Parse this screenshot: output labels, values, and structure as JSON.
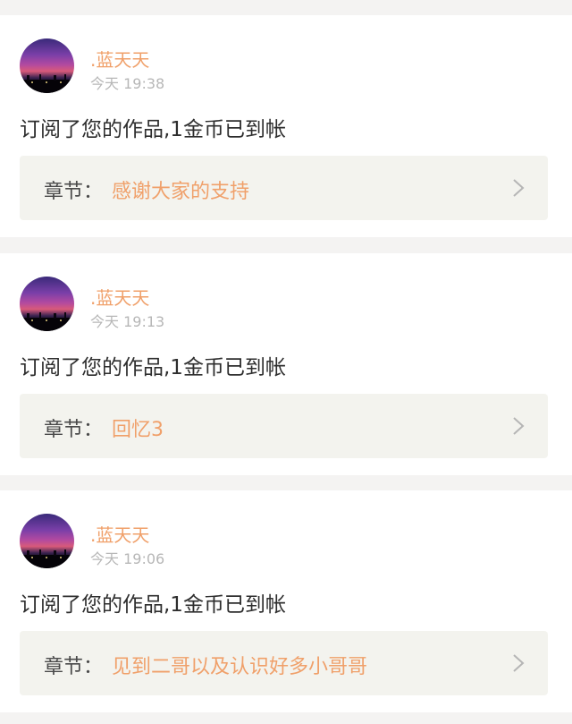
{
  "notifications": [
    {
      "username": ".蓝天天",
      "time": "今天 19:38",
      "message": "订阅了您的作品,1金币已到帐",
      "chapter_prefix": "章节：",
      "chapter_title": "感谢大家的支持"
    },
    {
      "username": ".蓝天天",
      "time": "今天 19:13",
      "message": "订阅了您的作品,1金币已到帐",
      "chapter_prefix": "章节：",
      "chapter_title": "回忆3"
    },
    {
      "username": ".蓝天天",
      "time": "今天 19:06",
      "message": "订阅了您的作品,1金币已到帐",
      "chapter_prefix": "章节：",
      "chapter_title": "见到二哥以及认识好多小哥哥"
    }
  ],
  "colors": {
    "accent": "#f0a06a",
    "page_background": "#f4f3f2",
    "card_background": "#ffffff",
    "chapter_background": "#f3f3ee",
    "timestamp": "#b7b7b7",
    "body_text": "#2e2e2e"
  },
  "icons": {
    "avatar": "sunset-photo-avatar",
    "chevron": "chevron-right-icon"
  }
}
